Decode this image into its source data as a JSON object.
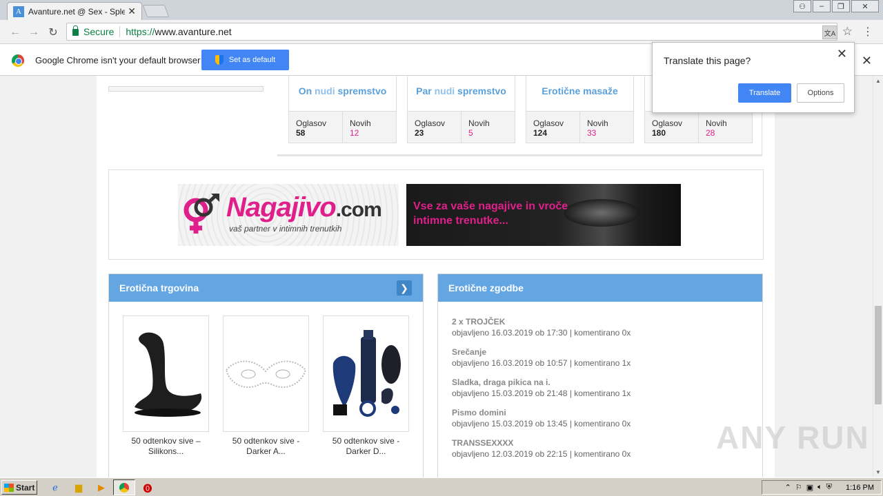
{
  "browser": {
    "tab_title": "Avanture.net @ Sex - Spletn",
    "tab_favicon_letter": "A",
    "secure_label": "Secure",
    "url_scheme": "https://",
    "url_host": "www.avanture.net"
  },
  "infobar": {
    "message": "Google Chrome isn't your default browser",
    "set_default_label": "Set as default"
  },
  "translate_popup": {
    "title": "Translate this page?",
    "translate_label": "Translate",
    "options_label": "Options"
  },
  "categories": [
    {
      "title_a": "On",
      "title_b": "nudi",
      "title_c": "spremstvo",
      "oglasov_label": "Oglasov",
      "oglasov": "58",
      "novih_label": "Novih",
      "novih": "12"
    },
    {
      "title_a": "Par",
      "title_b": "nudi",
      "title_c": "spremstvo",
      "oglasov_label": "Oglasov",
      "oglasov": "23",
      "novih_label": "Novih",
      "novih": "5"
    },
    {
      "title_a": "Erotične masaže",
      "title_b": "",
      "title_c": "",
      "oglasov_label": "Oglasov",
      "oglasov": "124",
      "novih_label": "Novih",
      "novih": "33"
    },
    {
      "title_a": "",
      "title_b": "",
      "title_c": "",
      "oglasov_label": "Oglasov",
      "oglasov": "180",
      "novih_label": "Novih",
      "novih": "28"
    }
  ],
  "banner": {
    "logo_main": "Nagajivo",
    "logo_tld": ".com",
    "logo_tagline": "vaš partner v intimnih trenutkih",
    "slogan_line1": "Vse za vaše nagajive in vroče",
    "slogan_line2": "intimne trenutke..."
  },
  "shop": {
    "title": "Erotična trgovina",
    "products": [
      {
        "name_l1": "50 odtenkov sive –",
        "name_l2": "Silikons..."
      },
      {
        "name_l1": "50 odtenkov sive -",
        "name_l2": "Darker A..."
      },
      {
        "name_l1": "50 odtenkov sive -",
        "name_l2": "Darker D..."
      }
    ]
  },
  "stories": {
    "title": "Erotične zgodbe",
    "items": [
      {
        "title": "2 x TROJČEK",
        "meta": "objavljeno 16.03.2019 ob 17:30 | komentirano 0x"
      },
      {
        "title": "Srečanje",
        "meta": "objavljeno 16.03.2019 ob 10:57 | komentirano 1x"
      },
      {
        "title": "Sladka, draga pikica na i.",
        "meta": "objavljeno 15.03.2019 ob 21:48 | komentirano 1x"
      },
      {
        "title": "Pismo domini",
        "meta": "objavljeno 15.03.2019 ob 13:45 | komentirano 0x"
      },
      {
        "title": "TRANSSEXXXX",
        "meta": "objavljeno 12.03.2019 ob 22:15 | komentirano 0x"
      }
    ]
  },
  "watermark": "ANY RUN",
  "taskbar": {
    "start_label": "Start",
    "clock": "1:16 PM"
  },
  "colors": {
    "accent_blue": "#64a6e2",
    "pink": "#e0208a",
    "chrome_blue": "#4285f4"
  }
}
